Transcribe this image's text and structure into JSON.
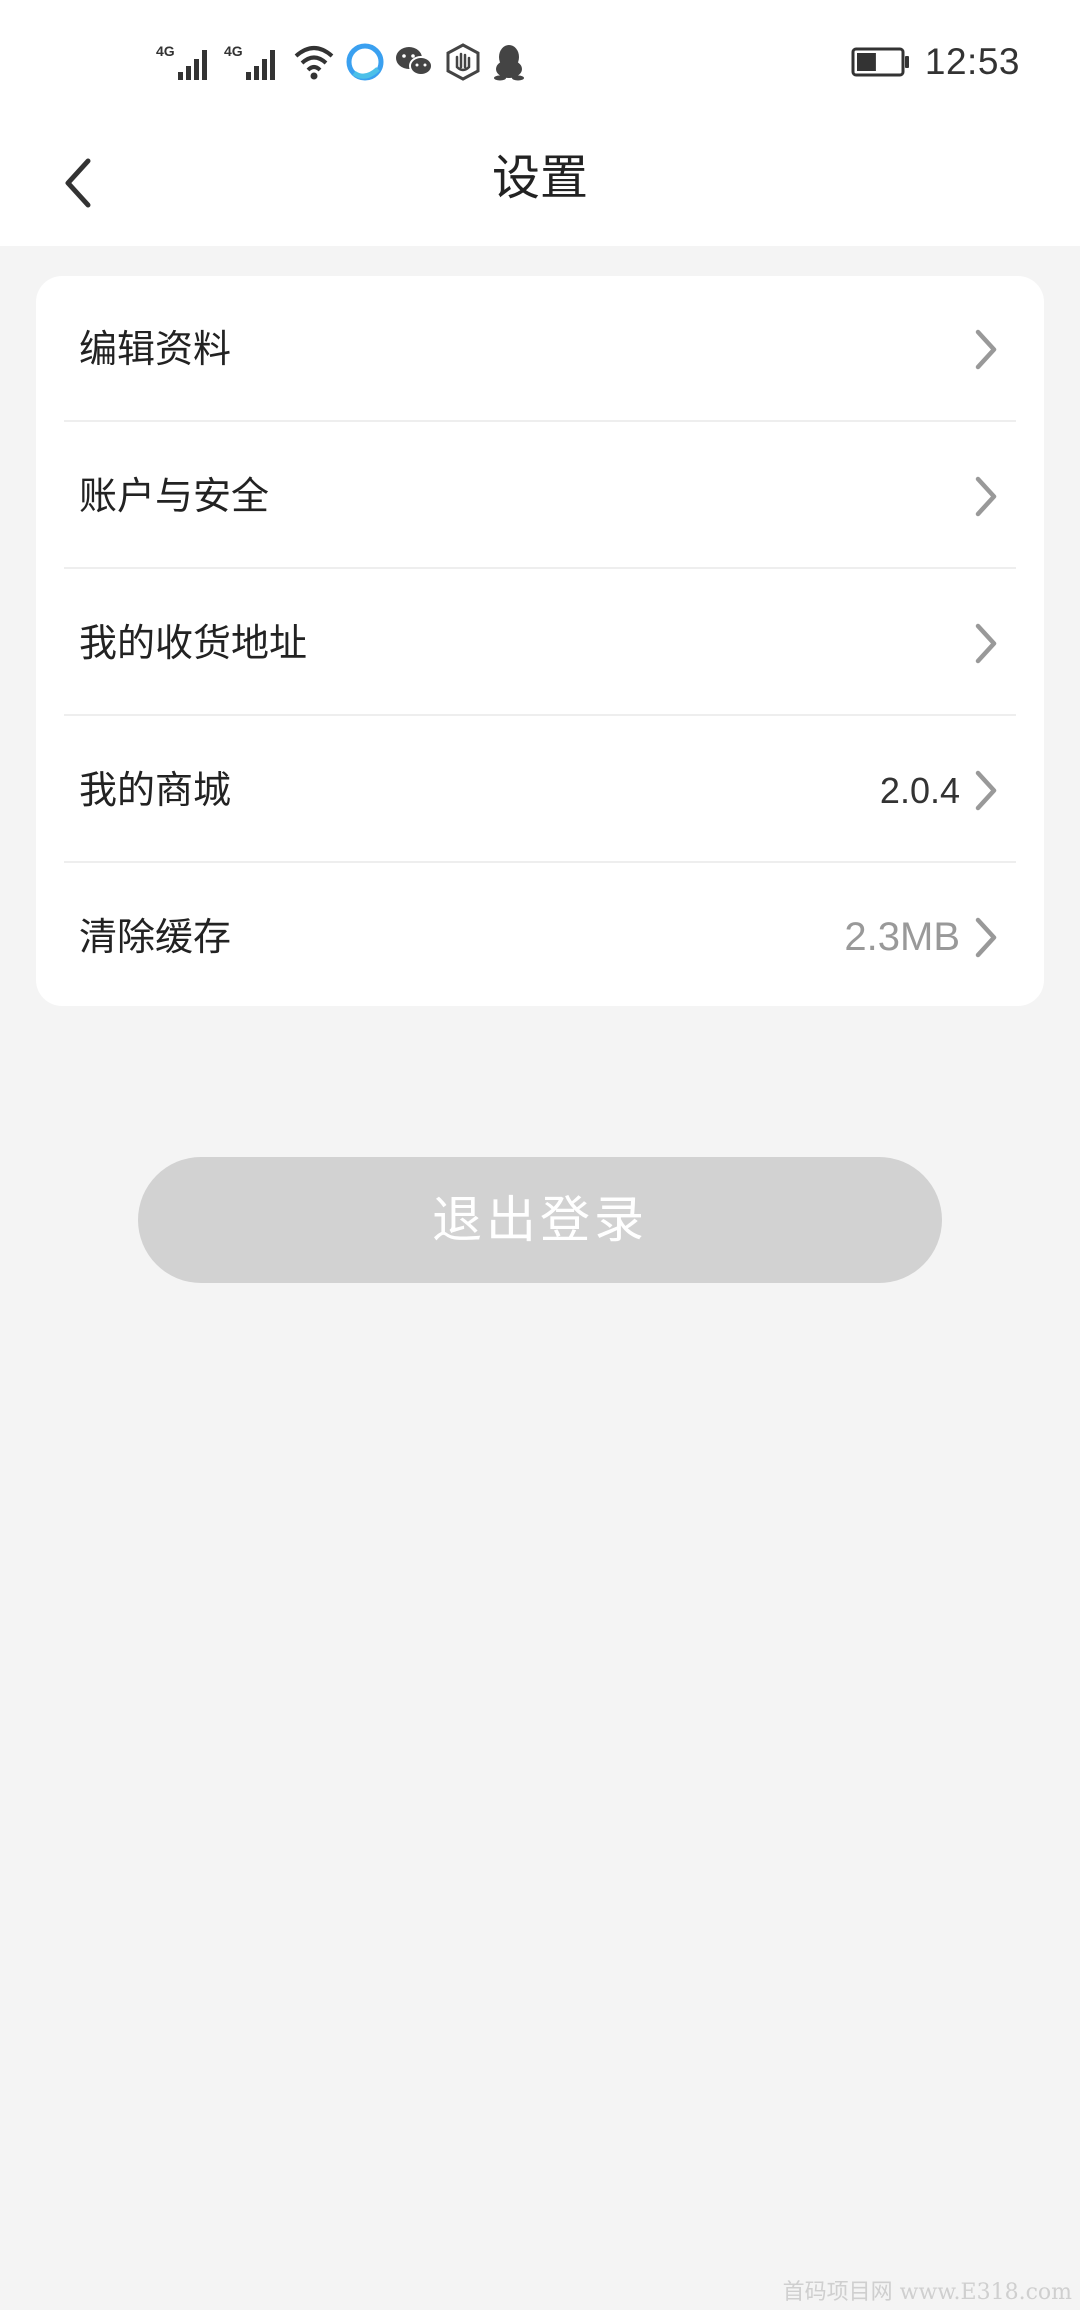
{
  "status_bar": {
    "signal_1_label": "4G",
    "signal_2_label": "4G",
    "icons": [
      "signal-bars-icon",
      "signal-bars-icon",
      "wifi-icon",
      "browser-app-icon",
      "wechat-icon",
      "security-hand-icon",
      "qq-penguin-icon",
      "battery-icon"
    ],
    "time": "12:53",
    "battery_level": 0.45
  },
  "nav": {
    "title": "设置",
    "back_icon": "chevron-left-icon"
  },
  "settings": {
    "items": [
      {
        "label": "编辑资料",
        "value": ""
      },
      {
        "label": "账户与安全",
        "value": ""
      },
      {
        "label": "我的收货地址",
        "value": ""
      },
      {
        "label": "我的商城",
        "value": "2.0.4"
      },
      {
        "label": "清除缓存",
        "value": "2.3MB"
      }
    ],
    "chevron_icon": "chevron-right-icon"
  },
  "logout": {
    "label": "退出登录"
  },
  "watermark": {
    "text": "首码项目网 www.E318.com"
  },
  "colors": {
    "page_background": "#f4f4f4",
    "card_background": "#ffffff",
    "logout_background": "#d2d2d2",
    "muted_text": "#999999",
    "chevron": "#999999"
  }
}
